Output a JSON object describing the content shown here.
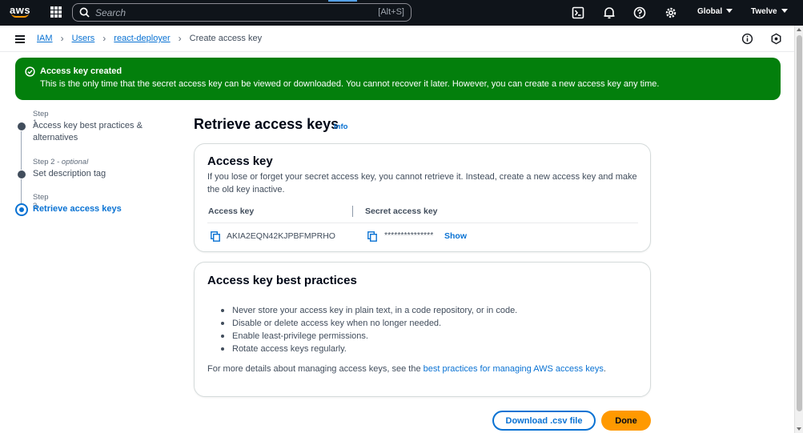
{
  "topbar": {
    "logo": "aws",
    "search_placeholder": "Search",
    "search_shortcut": "[Alt+S]",
    "region": "Global",
    "account": "Twelve",
    "icons": [
      "cloudshell-icon",
      "bell-icon",
      "help-icon",
      "gear-icon"
    ]
  },
  "breadcrumb": {
    "items": [
      "IAM",
      "Users",
      "react-deployer"
    ],
    "current": "Create access key"
  },
  "flash": {
    "title": "Access key created",
    "message": "This is the only time that the secret access key can be viewed or downloaded. You cannot recover it later. However, you can create a new access key any time.",
    "color": "#037f0c"
  },
  "steps": [
    {
      "num": "Step 1",
      "optional": "",
      "title": "Access key best practices & alternatives"
    },
    {
      "num": "Step 2",
      "optional": "optional",
      "title": "Set description tag"
    },
    {
      "num": "Step 3",
      "optional": "",
      "title": "Retrieve access keys"
    }
  ],
  "page": {
    "title": "Retrieve access keys",
    "info": "Info"
  },
  "access_key": {
    "heading": "Access key",
    "description": "If you lose or forget your secret access key, you cannot retrieve it. Instead, create a new access key and make the old key inactive.",
    "col_access": "Access key",
    "col_secret": "Secret access key",
    "access_value": "AKIA2EQN42KJPBFMPRHO",
    "secret_masked": "***************",
    "show_label": "Show"
  },
  "best_practices": {
    "heading": "Access key best practices",
    "items": [
      "Never store your access key in plain text, in a code repository, or in code.",
      "Disable or delete access key when no longer needed.",
      "Enable least-privilege permissions.",
      "Rotate access keys regularly."
    ],
    "more_prefix": "For more details about managing access keys, see the ",
    "more_link": "best practices for managing AWS access keys",
    "more_suffix": "."
  },
  "actions": {
    "download": "Download .csv file",
    "done": "Done"
  },
  "colors": {
    "accent": "#0972d3",
    "primary_button": "#ff9900",
    "topbar": "#0f141a"
  }
}
